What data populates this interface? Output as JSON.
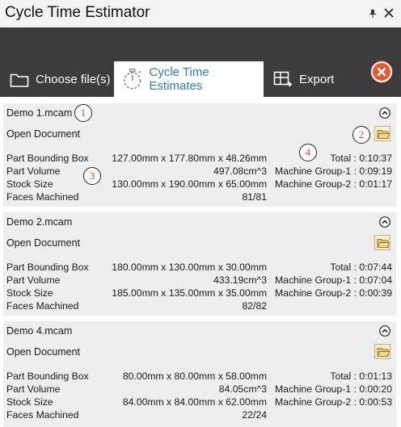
{
  "window": {
    "title": "Cycle Time Estimator"
  },
  "tabs": [
    {
      "label": "Choose file(s)",
      "icon": "folder-icon"
    },
    {
      "label": "Cycle Time Estimates",
      "icon": "stopwatch-icon"
    },
    {
      "label": "Export",
      "icon": "export-icon"
    }
  ],
  "labels": {
    "open_document": "Open Document",
    "part_bounding_box": "Part Bounding Box",
    "part_volume": "Part Volume",
    "stock_size": "Stock Size",
    "faces_machined": "Faces Machined"
  },
  "cards": [
    {
      "file": "Demo 1.mcam",
      "bounding_box": "127.00mm x 177.80mm x 48.26mm",
      "volume": "497.08cm^3",
      "stock": "130.00mm x 190.00mm x 65.00mm",
      "faces": "81/81",
      "total": "Total : 0:10:37",
      "group1": "Machine Group-1 : 0:09:19",
      "group2": "Machine Group-2 : 0:01:17"
    },
    {
      "file": "Demo 2.mcam",
      "bounding_box": "180.00mm x 130.00mm x 30.00mm",
      "volume": "433.19cm^3",
      "stock": "185.00mm x 135.00mm x 35.00mm",
      "faces": "82/82",
      "total": "Total : 0:07:44",
      "group1": "Machine Group-1 : 0:07:04",
      "group2": "Machine Group-2 : 0:00:39"
    },
    {
      "file": "Demo 4.mcam",
      "bounding_box": "80.00mm x 80.00mm x 58.00mm",
      "volume": "84.05cm^3",
      "stock": "84.00mm x 84.00mm x 62.00mm",
      "faces": "22/24",
      "total": "Total : 0:01:13",
      "group1": "Machine Group-1 : 0:00:20",
      "group2": "Machine Group-2 : 0:00:53"
    }
  ],
  "markers": [
    "1",
    "2",
    "3",
    "4"
  ],
  "colors": {
    "accent": "#2c7cc0",
    "header_bg": "#3c3c3c",
    "card_bg": "#eeeeee",
    "close_red": "#e45a33",
    "marker_text": "#dd4444"
  }
}
